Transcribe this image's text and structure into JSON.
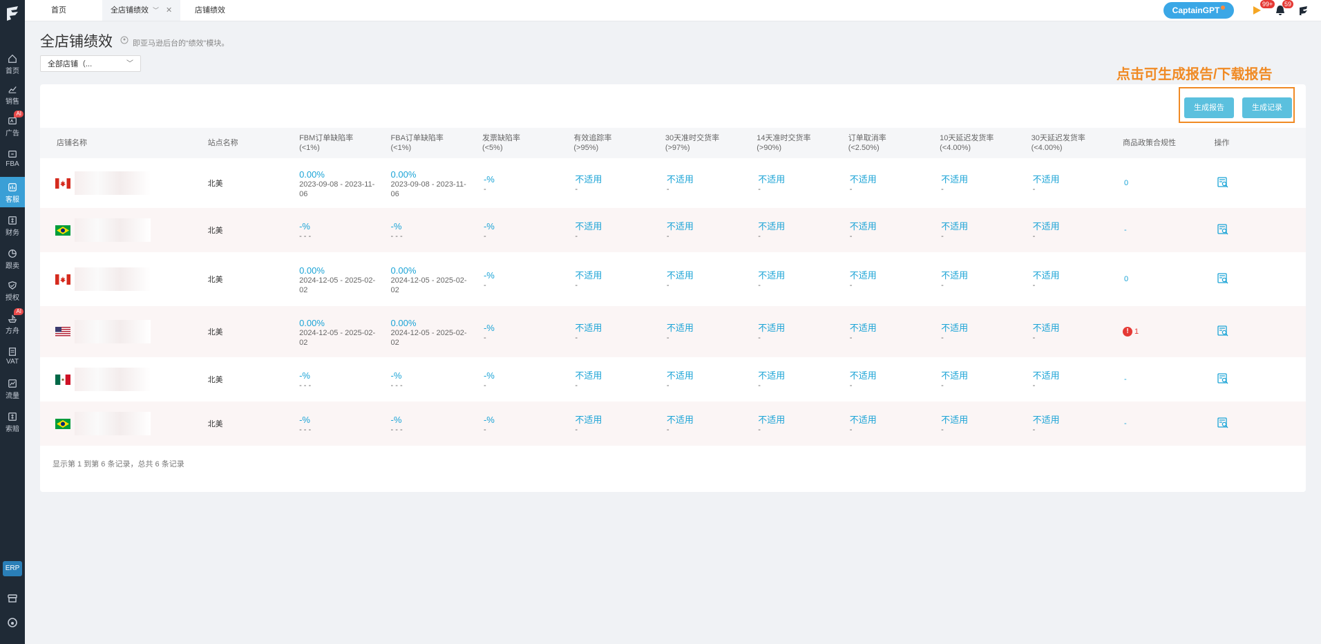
{
  "tabs": [
    {
      "label": "首页",
      "active": false
    },
    {
      "label": "全店铺绩效",
      "active": true
    },
    {
      "label": "店铺绩效",
      "active": false
    }
  ],
  "captain_label": "CaptainGPT",
  "badges": {
    "play": "99+",
    "bell": "59"
  },
  "sidebar": {
    "items": [
      {
        "label": "首页",
        "icon": "home-icon",
        "active": false,
        "ai": false
      },
      {
        "label": "销售",
        "icon": "sales-chart-icon",
        "active": false,
        "ai": false
      },
      {
        "label": "广告",
        "icon": "ad-icon",
        "active": false,
        "ai": true
      },
      {
        "label": "FBA",
        "icon": "fba-box-icon",
        "active": false,
        "ai": false
      },
      {
        "label": "客服",
        "icon": "service-icon",
        "active": true,
        "ai": false
      },
      {
        "label": "财务",
        "icon": "finance-icon",
        "active": false,
        "ai": false
      },
      {
        "label": "跟卖",
        "icon": "pie-icon",
        "active": false,
        "ai": false
      },
      {
        "label": "授权",
        "icon": "shield-icon",
        "active": false,
        "ai": false
      },
      {
        "label": "方舟",
        "icon": "ark-icon",
        "active": false,
        "ai": true
      },
      {
        "label": "VAT",
        "icon": "vat-icon",
        "active": false,
        "ai": false
      },
      {
        "label": "流量",
        "icon": "traffic-icon",
        "active": false,
        "ai": false
      },
      {
        "label": "索赔",
        "icon": "claim-icon",
        "active": false,
        "ai": false
      }
    ],
    "ai_badge": "AI",
    "erp_label": "ERP"
  },
  "page": {
    "title": "全店铺绩效",
    "hint": "即亚马逊后台的“绩效”模块。",
    "store_select": "全部店铺（..."
  },
  "annotation": "点击可生成报告/下载报告",
  "buttons": {
    "generate": "生成报告",
    "records": "生成记录"
  },
  "table": {
    "headers": [
      {
        "label": "店铺名称",
        "sub": ""
      },
      {
        "label": "站点名称",
        "sub": ""
      },
      {
        "label": "FBM订单缺陷率",
        "sub": "(<1%)"
      },
      {
        "label": "FBA订单缺陷率",
        "sub": "(<1%)"
      },
      {
        "label": "发票缺陷率",
        "sub": "(<5%)"
      },
      {
        "label": "有效追踪率",
        "sub": "(>95%)"
      },
      {
        "label": "30天准时交货率",
        "sub": "(>97%)"
      },
      {
        "label": "14天准时交货率",
        "sub": "(>90%)"
      },
      {
        "label": "订单取消率",
        "sub": "(<2.50%)"
      },
      {
        "label": "10天延迟发货率",
        "sub": "(<4.00%)"
      },
      {
        "label": "30天延迟发货率",
        "sub": "(<4.00%)"
      },
      {
        "label": "商品政策合规性",
        "sub": ""
      },
      {
        "label": "操作",
        "sub": ""
      }
    ],
    "rows": [
      {
        "flag": "ca",
        "site": "北美",
        "fbm": {
          "v": "0.00%",
          "d": "2023-09-08 - 2023-11-06"
        },
        "fba": {
          "v": "0.00%",
          "d": "2023-09-08 - 2023-11-06"
        },
        "invoice": {
          "v": "-%",
          "d": "-"
        },
        "na": [
          "不适用",
          "不适用",
          "不适用",
          "不适用",
          "不适用",
          "不适用"
        ],
        "na_sub": "-",
        "compliance": "0",
        "warn": false
      },
      {
        "flag": "br",
        "site": "北美",
        "fbm": {
          "v": "-%",
          "d": "- - -"
        },
        "fba": {
          "v": "-%",
          "d": "- - -"
        },
        "invoice": {
          "v": "-%",
          "d": "-"
        },
        "na": [
          "不适用",
          "不适用",
          "不适用",
          "不适用",
          "不适用",
          "不适用"
        ],
        "na_sub": "-",
        "compliance": "-",
        "warn": false
      },
      {
        "flag": "ca",
        "site": "北美",
        "fbm": {
          "v": "0.00%",
          "d": "2024-12-05 - 2025-02-02"
        },
        "fba": {
          "v": "0.00%",
          "d": "2024-12-05 - 2025-02-02"
        },
        "invoice": {
          "v": "-%",
          "d": "-"
        },
        "na": [
          "不适用",
          "不适用",
          "不适用",
          "不适用",
          "不适用",
          "不适用"
        ],
        "na_sub": "-",
        "compliance": "0",
        "warn": false
      },
      {
        "flag": "us",
        "site": "北美",
        "fbm": {
          "v": "0.00%",
          "d": "2024-12-05 - 2025-02-02"
        },
        "fba": {
          "v": "0.00%",
          "d": "2024-12-05 - 2025-02-02"
        },
        "invoice": {
          "v": "-%",
          "d": "-"
        },
        "na": [
          "不适用",
          "不适用",
          "不适用",
          "不适用",
          "不适用",
          "不适用"
        ],
        "na_sub": "-",
        "compliance": "1",
        "warn": true
      },
      {
        "flag": "mx",
        "site": "北美",
        "fbm": {
          "v": "-%",
          "d": "- - -"
        },
        "fba": {
          "v": "-%",
          "d": "- - -"
        },
        "invoice": {
          "v": "-%",
          "d": "-"
        },
        "na": [
          "不适用",
          "不适用",
          "不适用",
          "不适用",
          "不适用",
          "不适用"
        ],
        "na_sub": "-",
        "compliance": "-",
        "warn": false
      },
      {
        "flag": "br",
        "site": "北美",
        "fbm": {
          "v": "-%",
          "d": "- - -"
        },
        "fba": {
          "v": "-%",
          "d": "- - -"
        },
        "invoice": {
          "v": "-%",
          "d": "-"
        },
        "na": [
          "不适用",
          "不适用",
          "不适用",
          "不适用",
          "不适用",
          "不适用"
        ],
        "na_sub": "-",
        "compliance": "-",
        "warn": false
      }
    ]
  },
  "footer": "显示第 1 到第 6 条记录，总共 6 条记录",
  "colors": {
    "accent": "#1aa3d6",
    "sidebar": "#1f2a36",
    "annotation": "#f08a24",
    "button": "#5bc0de"
  }
}
